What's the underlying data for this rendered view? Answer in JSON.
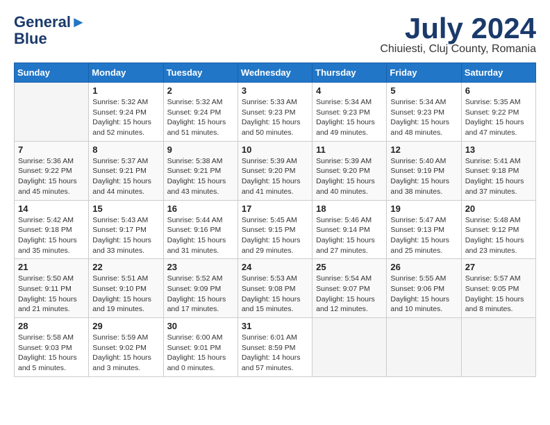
{
  "header": {
    "logo_line1": "General",
    "logo_line2": "Blue",
    "month_title": "July 2024",
    "location": "Chiuiesti, Cluj County, Romania"
  },
  "days_of_week": [
    "Sunday",
    "Monday",
    "Tuesday",
    "Wednesday",
    "Thursday",
    "Friday",
    "Saturday"
  ],
  "weeks": [
    [
      {
        "day": "",
        "info": ""
      },
      {
        "day": "1",
        "info": "Sunrise: 5:32 AM\nSunset: 9:24 PM\nDaylight: 15 hours\nand 52 minutes."
      },
      {
        "day": "2",
        "info": "Sunrise: 5:32 AM\nSunset: 9:24 PM\nDaylight: 15 hours\nand 51 minutes."
      },
      {
        "day": "3",
        "info": "Sunrise: 5:33 AM\nSunset: 9:23 PM\nDaylight: 15 hours\nand 50 minutes."
      },
      {
        "day": "4",
        "info": "Sunrise: 5:34 AM\nSunset: 9:23 PM\nDaylight: 15 hours\nand 49 minutes."
      },
      {
        "day": "5",
        "info": "Sunrise: 5:34 AM\nSunset: 9:23 PM\nDaylight: 15 hours\nand 48 minutes."
      },
      {
        "day": "6",
        "info": "Sunrise: 5:35 AM\nSunset: 9:22 PM\nDaylight: 15 hours\nand 47 minutes."
      }
    ],
    [
      {
        "day": "7",
        "info": "Sunrise: 5:36 AM\nSunset: 9:22 PM\nDaylight: 15 hours\nand 45 minutes."
      },
      {
        "day": "8",
        "info": "Sunrise: 5:37 AM\nSunset: 9:21 PM\nDaylight: 15 hours\nand 44 minutes."
      },
      {
        "day": "9",
        "info": "Sunrise: 5:38 AM\nSunset: 9:21 PM\nDaylight: 15 hours\nand 43 minutes."
      },
      {
        "day": "10",
        "info": "Sunrise: 5:39 AM\nSunset: 9:20 PM\nDaylight: 15 hours\nand 41 minutes."
      },
      {
        "day": "11",
        "info": "Sunrise: 5:39 AM\nSunset: 9:20 PM\nDaylight: 15 hours\nand 40 minutes."
      },
      {
        "day": "12",
        "info": "Sunrise: 5:40 AM\nSunset: 9:19 PM\nDaylight: 15 hours\nand 38 minutes."
      },
      {
        "day": "13",
        "info": "Sunrise: 5:41 AM\nSunset: 9:18 PM\nDaylight: 15 hours\nand 37 minutes."
      }
    ],
    [
      {
        "day": "14",
        "info": "Sunrise: 5:42 AM\nSunset: 9:18 PM\nDaylight: 15 hours\nand 35 minutes."
      },
      {
        "day": "15",
        "info": "Sunrise: 5:43 AM\nSunset: 9:17 PM\nDaylight: 15 hours\nand 33 minutes."
      },
      {
        "day": "16",
        "info": "Sunrise: 5:44 AM\nSunset: 9:16 PM\nDaylight: 15 hours\nand 31 minutes."
      },
      {
        "day": "17",
        "info": "Sunrise: 5:45 AM\nSunset: 9:15 PM\nDaylight: 15 hours\nand 29 minutes."
      },
      {
        "day": "18",
        "info": "Sunrise: 5:46 AM\nSunset: 9:14 PM\nDaylight: 15 hours\nand 27 minutes."
      },
      {
        "day": "19",
        "info": "Sunrise: 5:47 AM\nSunset: 9:13 PM\nDaylight: 15 hours\nand 25 minutes."
      },
      {
        "day": "20",
        "info": "Sunrise: 5:48 AM\nSunset: 9:12 PM\nDaylight: 15 hours\nand 23 minutes."
      }
    ],
    [
      {
        "day": "21",
        "info": "Sunrise: 5:50 AM\nSunset: 9:11 PM\nDaylight: 15 hours\nand 21 minutes."
      },
      {
        "day": "22",
        "info": "Sunrise: 5:51 AM\nSunset: 9:10 PM\nDaylight: 15 hours\nand 19 minutes."
      },
      {
        "day": "23",
        "info": "Sunrise: 5:52 AM\nSunset: 9:09 PM\nDaylight: 15 hours\nand 17 minutes."
      },
      {
        "day": "24",
        "info": "Sunrise: 5:53 AM\nSunset: 9:08 PM\nDaylight: 15 hours\nand 15 minutes."
      },
      {
        "day": "25",
        "info": "Sunrise: 5:54 AM\nSunset: 9:07 PM\nDaylight: 15 hours\nand 12 minutes."
      },
      {
        "day": "26",
        "info": "Sunrise: 5:55 AM\nSunset: 9:06 PM\nDaylight: 15 hours\nand 10 minutes."
      },
      {
        "day": "27",
        "info": "Sunrise: 5:57 AM\nSunset: 9:05 PM\nDaylight: 15 hours\nand 8 minutes."
      }
    ],
    [
      {
        "day": "28",
        "info": "Sunrise: 5:58 AM\nSunset: 9:03 PM\nDaylight: 15 hours\nand 5 minutes."
      },
      {
        "day": "29",
        "info": "Sunrise: 5:59 AM\nSunset: 9:02 PM\nDaylight: 15 hours\nand 3 minutes."
      },
      {
        "day": "30",
        "info": "Sunrise: 6:00 AM\nSunset: 9:01 PM\nDaylight: 15 hours\nand 0 minutes."
      },
      {
        "day": "31",
        "info": "Sunrise: 6:01 AM\nSunset: 8:59 PM\nDaylight: 14 hours\nand 57 minutes."
      },
      {
        "day": "",
        "info": ""
      },
      {
        "day": "",
        "info": ""
      },
      {
        "day": "",
        "info": ""
      }
    ]
  ]
}
